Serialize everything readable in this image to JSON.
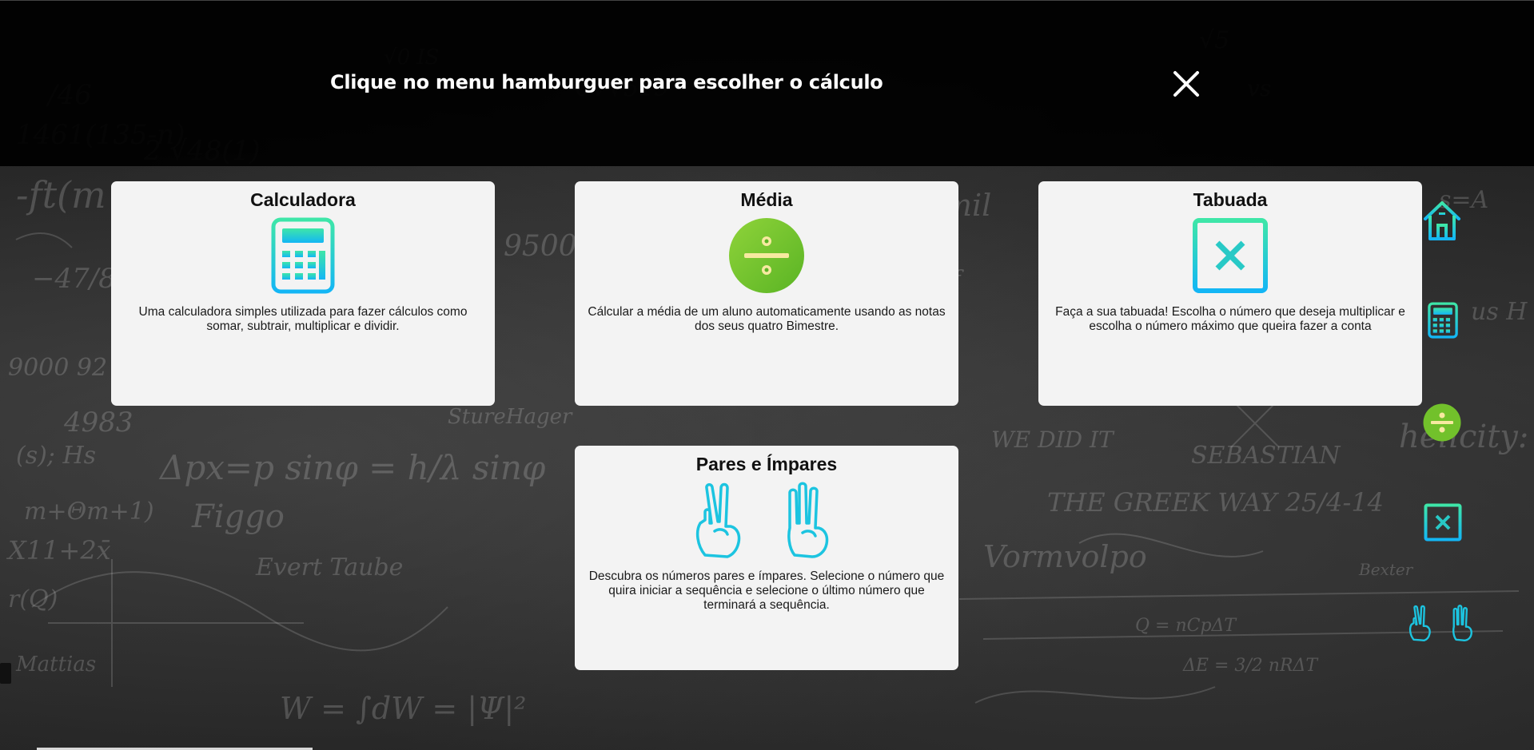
{
  "header": {
    "title": "Clique no menu hamburguer para escolher o cálculo"
  },
  "cards": [
    {
      "title": "Calculadora",
      "icon": "calculator-icon",
      "description": "Uma calculadora simples utilizada para fazer cálculos como somar, subtrair, multiplicar e dividir."
    },
    {
      "title": "Média",
      "icon": "divide-icon",
      "description": "Cálcular a média de um aluno automaticamente usando as notas dos seus quatro Bimestre."
    },
    {
      "title": "Tabuada",
      "icon": "multiply-icon",
      "description": "Faça a sua tabuada! Escolha o número que deseja multiplicar e escolha o número máximo que queira fazer a conta"
    },
    {
      "title": "Pares e Ímpares",
      "icon": "hands-icon",
      "description": "Descubra os números pares e ímpares. Selecione o número que quira iniciar a sequência e selecione o último número que terminará a sequência."
    }
  ],
  "side_menu": [
    "home-icon",
    "calculator-icon",
    "divide-icon",
    "multiply-icon",
    "hands-icon"
  ],
  "colors": {
    "header_bg": "#000000",
    "card_bg": "#f3f3f3",
    "icon_gradient_start": "#3ee6a8",
    "icon_gradient_end": "#13b6f5",
    "divide_green": "#72c12b"
  }
}
